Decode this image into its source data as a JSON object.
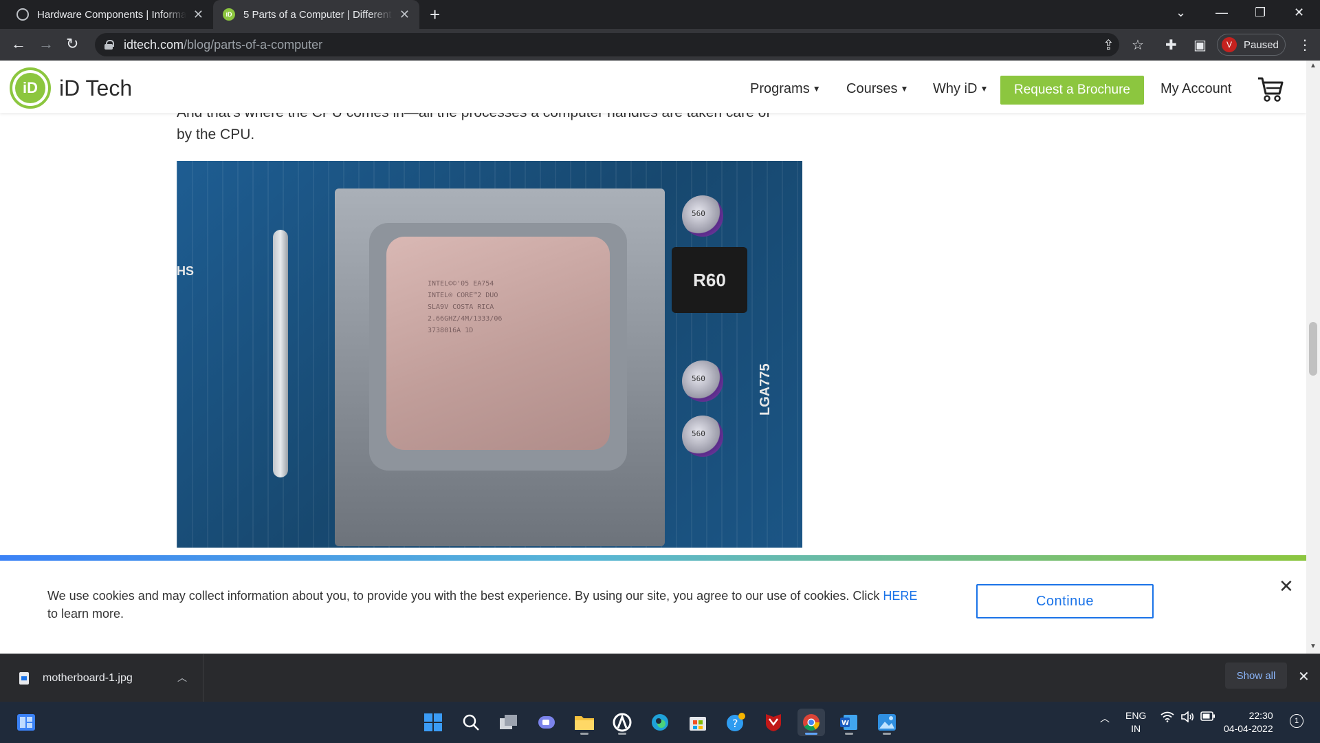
{
  "browser": {
    "tabs": [
      {
        "title": "Hardware Components | Informa",
        "favicon": "globe-icon",
        "active": false
      },
      {
        "title": "5 Parts of a Computer | Different",
        "favicon": "idtech-favicon",
        "active": true
      }
    ],
    "url_host": "idtech.com",
    "url_path": "/blog/parts-of-a-computer",
    "profile_initial": "V",
    "profile_status": "Paused"
  },
  "site": {
    "logo_text": "iD Tech",
    "logo_mark": "iD",
    "nav": {
      "programs": "Programs",
      "courses": "Courses",
      "why": "Why iD",
      "cta": "Request a Brochure",
      "account": "My Account"
    },
    "accent_color": "#8cc63f"
  },
  "article": {
    "paragraph": "And that's where the CPU comes in—all the processes a computer handles are taken care of by the CPU.",
    "image": {
      "cpu_marking": "INTEL©©'05 EA754\nINTEL® CORE™2 DUO\nSLA9V COSTA RICA\n2.66GHZ/4M/1333/06\n3738016A 1D",
      "inductor_label": "R60",
      "socket_label": "LGA775",
      "hs_label": "HS",
      "cap_label": "560"
    }
  },
  "cookie_banner": {
    "text_before": "We use cookies and may collect information about you, to provide you with the best experience. By using our site, you agree to our use of cookies. Click ",
    "link_text": "HERE",
    "text_after": " to learn more.",
    "button": "Continue"
  },
  "downloads": {
    "file_name": "motherboard-1.jpg",
    "show_all": "Show all"
  },
  "taskbar": {
    "language": "ENG",
    "region": "IN",
    "time": "22:30",
    "date": "04-04-2022",
    "notification_count": "1"
  }
}
